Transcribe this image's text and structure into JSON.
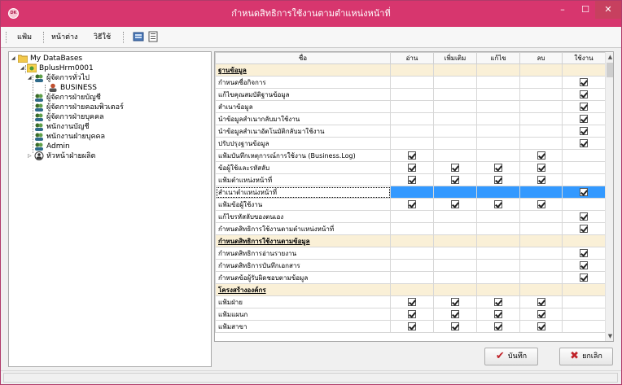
{
  "window": {
    "title": "กำหนดสิทธิการใช้งานตามตำแหน่งหน้าที่",
    "app_icon_text": "DK",
    "minimize_label": "–",
    "maximize_label": "☐",
    "close_label": "✕",
    "accent_color": "#d7366e"
  },
  "toolbar": {
    "menu_file": "แฟ้ม",
    "menu_window": "หน้าต่าง",
    "menu_howto": "วิธีใช้"
  },
  "tree": {
    "root": "My DataBases",
    "database": "BplusHrm0001",
    "nodes": [
      {
        "label": "ผู้จัดการทั่วไป",
        "level": 2,
        "expanded": true
      },
      {
        "label": "BUSINESS",
        "level": 3
      },
      {
        "label": "ผู้จัดการฝ่ายบัญชี",
        "level": 2
      },
      {
        "label": "ผู้จัดการฝ่ายคอมพิวเตอร์",
        "level": 2
      },
      {
        "label": "ผู้จัดการฝ่ายบุคคล",
        "level": 2
      },
      {
        "label": "พนักงานบัญชี",
        "level": 2
      },
      {
        "label": "พนักงานฝ่ายบุคคล",
        "level": 2
      },
      {
        "label": "Admin",
        "level": 2
      },
      {
        "label": "หัวหน้าฝ่ายผลิต",
        "level": 2,
        "collapsed": true
      }
    ]
  },
  "grid": {
    "headers": [
      "ชื่อ",
      "อ่าน",
      "เพิ่มเติม",
      "แก้ไข",
      "ลบ",
      "ใช้งาน"
    ],
    "rows": [
      {
        "type": "section",
        "name": "ฐานข้อมูล"
      },
      {
        "name": "กำหนดชื่อกิจการ",
        "checks": [
          false,
          false,
          false,
          false,
          true
        ]
      },
      {
        "name": "แก้ไขคุณสมบัติฐานข้อมูล",
        "checks": [
          false,
          false,
          false,
          false,
          true
        ]
      },
      {
        "name": "สำเนาข้อมูล",
        "checks": [
          false,
          false,
          false,
          false,
          true
        ]
      },
      {
        "name": "นำข้อมูลสำเนากลับมาใช้งาน",
        "checks": [
          false,
          false,
          false,
          false,
          true
        ]
      },
      {
        "name": "นำข้อมูลสำเนาอัตโนมัติกลับมาใช้งาน",
        "checks": [
          false,
          false,
          false,
          false,
          true
        ]
      },
      {
        "name": "ปรับปรุงฐานข้อมูล",
        "checks": [
          false,
          false,
          false,
          false,
          true
        ]
      },
      {
        "name": "แฟ้มบันทึกเหตุการณ์การใช้งาน (Business.Log)",
        "checks": [
          true,
          false,
          false,
          true,
          false
        ]
      },
      {
        "name": "ข้อผู้ใช้และรหัสลับ",
        "checks": [
          true,
          true,
          true,
          true,
          false
        ]
      },
      {
        "name": "แฟ้มตำแหน่งหน้าที่",
        "checks": [
          true,
          true,
          true,
          true,
          false
        ]
      },
      {
        "name": "สำเนาตำแหน่งหน้าที่",
        "checks": [
          false,
          false,
          false,
          false,
          true
        ],
        "selected": true
      },
      {
        "name": "แฟ้มข้อผู้ใช้งาน",
        "checks": [
          true,
          true,
          true,
          true,
          false
        ]
      },
      {
        "name": "แก้ไขรหัสลับของตนเอง",
        "checks": [
          false,
          false,
          false,
          false,
          true
        ]
      },
      {
        "name": "กำหนดสิทธิการใช้งานตามตำแหน่งหน้าที่",
        "checks": [
          false,
          false,
          false,
          false,
          true
        ]
      },
      {
        "type": "section",
        "name": "กำหนดสิทธิการใช้งานตามข้อมูล"
      },
      {
        "name": "กำหนดสิทธิการอ่านรายงาน",
        "checks": [
          false,
          false,
          false,
          false,
          true
        ]
      },
      {
        "name": "กำหนดสิทธิการบันทึกเอกสาร",
        "checks": [
          false,
          false,
          false,
          false,
          true
        ]
      },
      {
        "name": "กำหนดข้อผู้รับผิดชอบตามข้อมูล",
        "checks": [
          false,
          false,
          false,
          false,
          true
        ]
      },
      {
        "type": "section",
        "name": "โครงสร้างองค์กร"
      },
      {
        "name": "แฟ้มฝ่าย",
        "checks": [
          true,
          true,
          true,
          true,
          false
        ]
      },
      {
        "name": "แฟ้มแผนก",
        "checks": [
          true,
          true,
          true,
          true,
          false
        ]
      },
      {
        "name": "แฟ้มสาขา",
        "checks": [
          true,
          true,
          true,
          true,
          false
        ]
      }
    ]
  },
  "buttons": {
    "save_label": "บันทึก",
    "cancel_label": "ยกเลิก"
  }
}
